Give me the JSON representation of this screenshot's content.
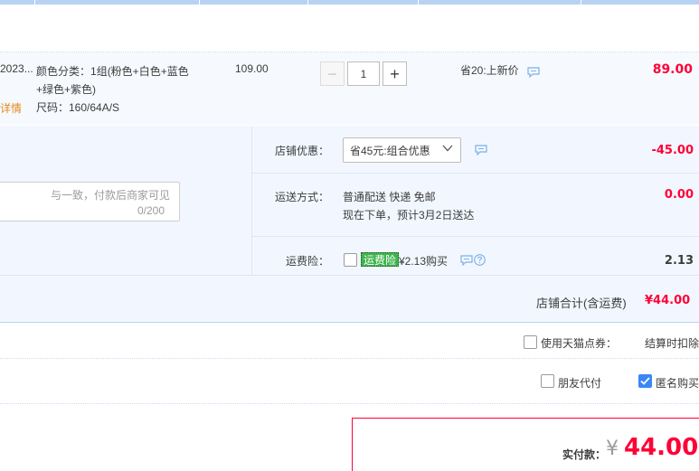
{
  "colors": {
    "accent_red": "#ff0036",
    "link_orange": "#e5891b",
    "panel_blue": "#f2f7ff",
    "border_blue": "#b7d2f3",
    "badge_green": "#3fb34f",
    "checkbox_blue": "#3a87f5"
  },
  "item": {
    "name_fragment": "2023...",
    "detail_link": "详情",
    "sku_color_label": "颜色分类：",
    "sku_color_line1": "1组(粉色+白色+蓝色",
    "sku_color_line2": "+绿色+紫色)",
    "sku_size": "尺码：160/64A/S",
    "unit_price": "109.00",
    "quantity": "1",
    "minus_symbol": "−",
    "plus_symbol": "+",
    "promo": "省20:上新价",
    "subtotal": "89.00"
  },
  "message": {
    "placeholder": "…与卖家协商一致，付款后商家可见",
    "visible_placeholder": "与一致，付款后商家可见",
    "counter": "0/200"
  },
  "shop_discount": {
    "label": "店铺优惠：",
    "selected": "省45元:组合优惠",
    "amount": "-45.00"
  },
  "shipping": {
    "label": "运送方式：",
    "method": "普通配送 快递 免邮",
    "eta": "现在下单，预计3月2日送达",
    "amount": "0.00"
  },
  "insurance": {
    "label": "运费险：",
    "badge": "运费险",
    "price_text": "¥2.13购买",
    "amount": "2.13",
    "checked": false
  },
  "shop_total": {
    "label": "店铺合计(含运费)",
    "amount": "¥44.00"
  },
  "options": {
    "tmall_points_label": "使用天猫点券：",
    "tmall_points_note": "结算时扣除",
    "friend_pay_label": "朋友代付",
    "anonymous_label": "匿名购买",
    "anonymous_checked": true
  },
  "payment": {
    "label": "实付款：",
    "currency": "¥",
    "amount": "44.00"
  }
}
